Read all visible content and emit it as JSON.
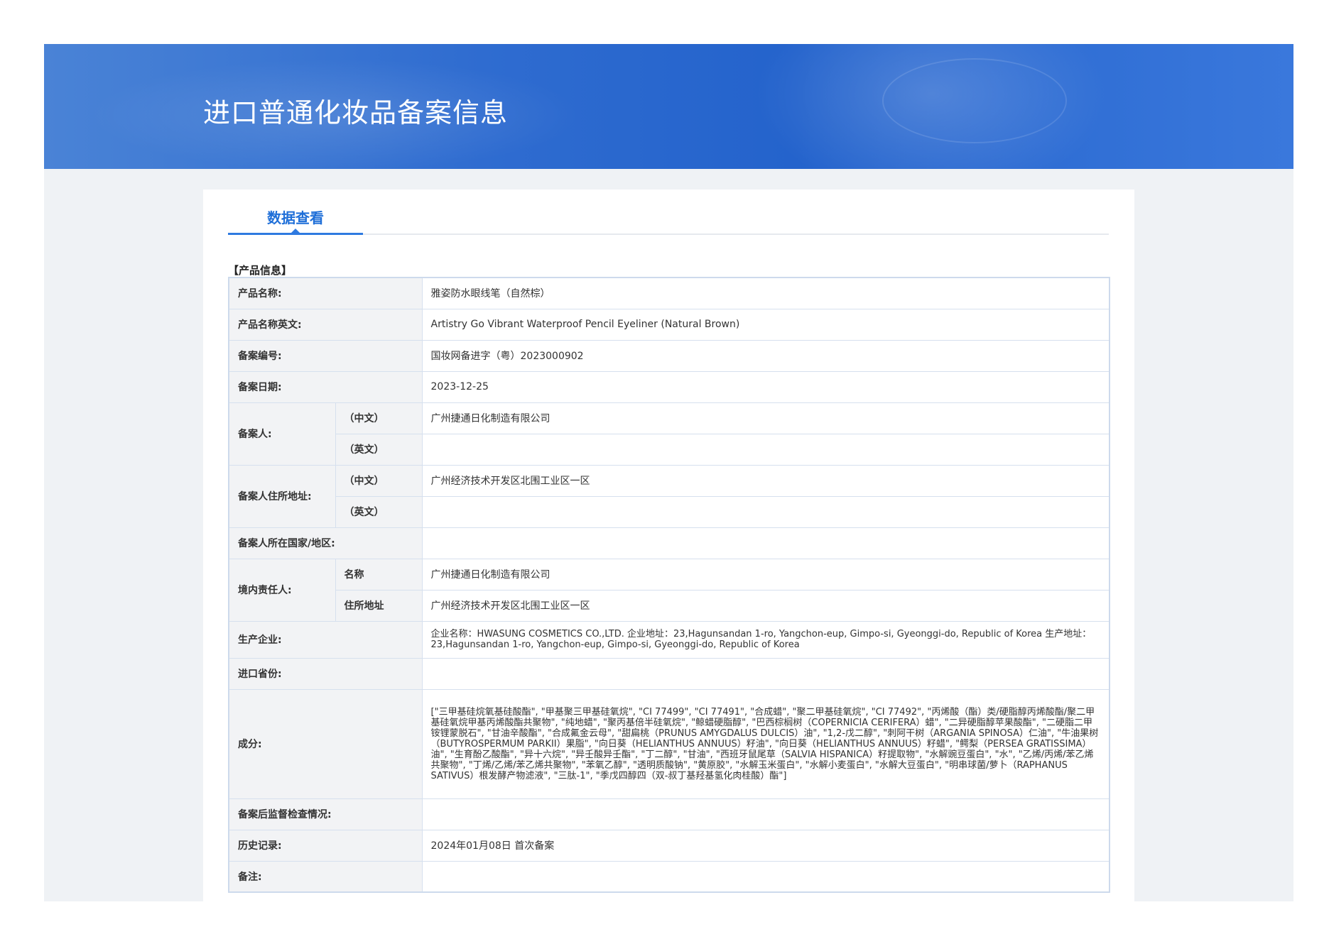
{
  "header": {
    "title": "进口普通化妆品备案信息"
  },
  "tabs": [
    {
      "label": "数据查看"
    }
  ],
  "section": {
    "title": "【产品信息】"
  },
  "rows": {
    "product_name": {
      "label": "产品名称:",
      "value": "雅姿防水眼线笔（自然棕）"
    },
    "product_name_en": {
      "label": "产品名称英文:",
      "value": "Artistry Go Vibrant Waterproof Pencil Eyeliner (Natural Brown)"
    },
    "filing_number": {
      "label": "备案编号:",
      "value": "国妆网备进字（粤）2023000902"
    },
    "filing_date": {
      "label": "备案日期:",
      "value": "2023-12-25"
    },
    "filer": {
      "label": "备案人:",
      "sub_cn": "（中文）",
      "value_cn": "广州捷通日化制造有限公司",
      "sub_en": "（英文）",
      "value_en": ""
    },
    "filer_address": {
      "label": "备案人住所地址:",
      "sub_cn": "（中文）",
      "value_cn": "广州经济技术开发区北围工业区一区",
      "sub_en": "（英文）",
      "value_en": ""
    },
    "filer_country": {
      "label": "备案人所在国家/地区:",
      "value": ""
    },
    "domestic_rep": {
      "label": "境内责任人:",
      "sub_name": "名称",
      "value_name": "广州捷通日化制造有限公司",
      "sub_addr": "住所地址",
      "value_addr": "广州经济技术开发区北围工业区一区"
    },
    "manufacturer": {
      "label": "生产企业:",
      "value": "企业名称：HWASUNG COSMETICS CO.,LTD. 企业地址：23,Hagunsandan 1-ro, Yangchon-eup, Gimpo-si, Gyeonggi-do, Republic of Korea 生产地址：23,Hagunsandan 1-ro, Yangchon-eup, Gimpo-si, Gyeonggi-do, Republic of Korea"
    },
    "import_province": {
      "label": "进口省份:",
      "value": ""
    },
    "ingredients": {
      "label": "成分:",
      "value": "[\"三甲基硅烷氧基硅酸酯\", \"甲基聚三甲基硅氧烷\", \"CI 77499\", \"CI 77491\", \"合成蜡\", \"聚二甲基硅氧烷\", \"CI 77492\", \"丙烯酸（酯）类/硬脂醇丙烯酸酯/聚二甲基硅氧烷甲基丙烯酸酯共聚物\", \"纯地蜡\", \"聚丙基倍半硅氧烷\", \"鲸蜡硬脂醇\", \"巴西棕榈树（COPERNICIA CERIFERA）蜡\", \"二异硬脂醇苹果酸酯\", \"二硬脂二甲铵锂蒙脱石\", \"甘油辛酸酯\", \"合成氟金云母\", \"甜扁桃（PRUNUS AMYGDALUS DULCIS）油\", \"1,2-戊二醇\", \"刺阿干树（ARGANIA SPINOSA）仁油\", \"牛油果树（BUTYROSPERMUM PARKII）果脂\", \"向日葵（HELIANTHUS ANNUUS）籽油\", \"向日葵（HELIANTHUS ANNUUS）籽蜡\", \"鳄梨（PERSEA GRATISSIMA）油\", \"生育酚乙酸酯\", \"异十六烷\", \"异壬酸异壬酯\", \"丁二醇\", \"甘油\", \"西班牙鼠尾草（SALVIA HISPANICA）籽提取物\", \"水解豌豆蛋白\", \"水\", \"乙烯/丙烯/苯乙烯共聚物\", \"丁烯/乙烯/苯乙烯共聚物\", \"苯氧乙醇\", \"透明质酸钠\", \"黄原胶\", \"水解玉米蛋白\", \"水解小麦蛋白\", \"水解大豆蛋白\", \"明串球菌/萝卜（RAPHANUS SATIVUS）根发酵产物滤液\", \"三肽-1\", \"季戊四醇四（双-叔丁基羟基氢化肉桂酸）酯\"]"
    },
    "post_inspection": {
      "label": "备案后监督检查情况:",
      "value": ""
    },
    "history": {
      "label": "历史记录:",
      "value": "2024年01月08日 首次备案"
    },
    "remarks": {
      "label": "备注:",
      "value": ""
    }
  },
  "colors": {
    "banner": "#2f6cd0",
    "tab_accent": "#1f6fd8",
    "label_bg": "#f2f3f5",
    "table_border": "#cddaec"
  }
}
